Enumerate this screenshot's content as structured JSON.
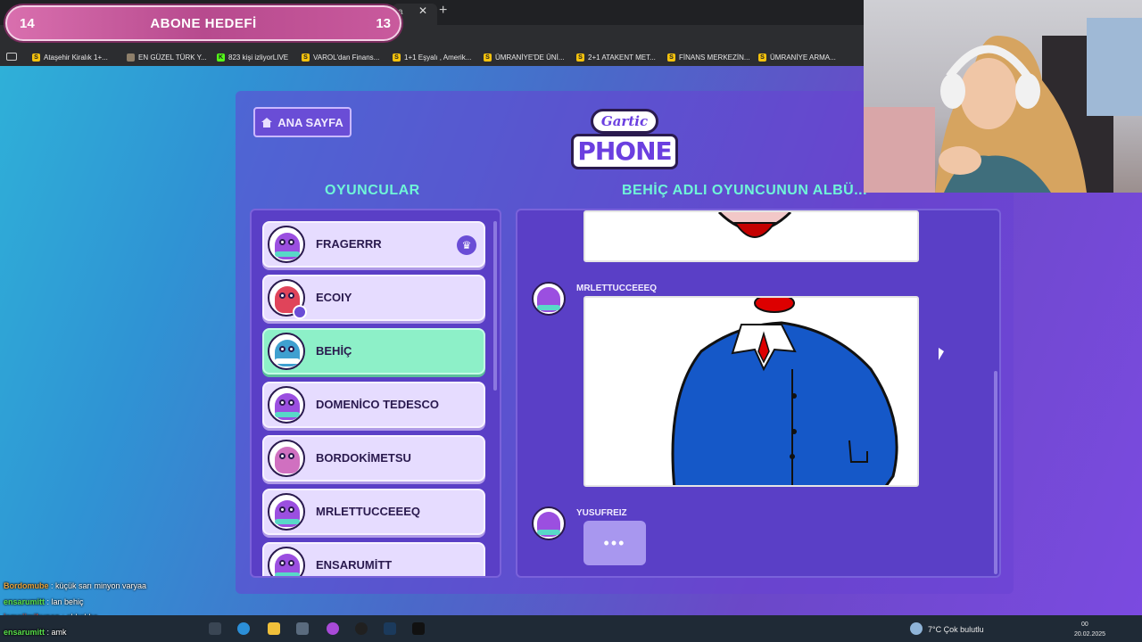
{
  "browser": {
    "tab_fragment": "a",
    "bookmarks": [
      {
        "icon": "S",
        "color": "#f4c20d",
        "label": "Ataşehir Kiralık 1+..."
      },
      {
        "icon": "",
        "color": "#8e7f6a",
        "label": "EN GÜZEL TÜRK Y..."
      },
      {
        "icon": "K",
        "color": "#53fc18",
        "label": "823 kişi izliyorLIVE"
      },
      {
        "icon": "S",
        "color": "#f4c20d",
        "label": "VAROL'dan Finans..."
      },
      {
        "icon": "S",
        "color": "#f4c20d",
        "label": "1+1 Eşyalı , Amerik..."
      },
      {
        "icon": "S",
        "color": "#f4c20d",
        "label": "ÜMRANİYE'DE ÜNİ..."
      },
      {
        "icon": "S",
        "color": "#f4c20d",
        "label": "2+1 ATAKENT MET..."
      },
      {
        "icon": "S",
        "color": "#f4c20d",
        "label": "FİNANS MERKEZİN..."
      },
      {
        "icon": "S",
        "color": "#f4c20d",
        "label": "ÜMRANİYE ARMA..."
      }
    ]
  },
  "goal": {
    "current": "14",
    "title": "ABONE HEDEFİ",
    "target": "13"
  },
  "game": {
    "home_label": "ANA SAYFA",
    "logo_top": "Gartic",
    "logo_bottom": "PHONE",
    "players_title": "OYUNCULAR",
    "album_title": "BEHİÇ ADLI OYUNCUNUN ALBÜ..."
  },
  "players": [
    {
      "name": "FRAGERRR",
      "color": "#9b4fe0",
      "crown": true,
      "active": false
    },
    {
      "name": "ECOIY",
      "color": "#e0445a",
      "badge": true,
      "active": false
    },
    {
      "name": "BEHİÇ",
      "color": "#3fa0d0",
      "active": true
    },
    {
      "name": "DOMENİCO TEDESCO",
      "color": "#9b4fe0",
      "active": false
    },
    {
      "name": "BORDOKİMETSU",
      "color": "#d070c0",
      "active": false
    },
    {
      "name": "MRLETTUCCEEEQ",
      "color": "#9b4fe0",
      "active": false
    },
    {
      "name": "ENSARUMİTT",
      "color": "#9b4fe0",
      "active": false
    }
  ],
  "album": {
    "entries": [
      {
        "author": "MRLETTUCCEEEQ"
      },
      {
        "author": "YUSUFREIZ",
        "typing": "•••"
      }
    ]
  },
  "chat": [
    {
      "user": "Bordomube",
      "color": "#e8a33d",
      "text": ": küçük sarı minyon varyaa"
    },
    {
      "user": "ensarumitt",
      "color": "#58e04a",
      "text": ": lan behiç"
    },
    {
      "user": "jempiimikunan",
      "color": "#d0443a",
      "text": ": ahhahha"
    },
    {
      "user": "ensarumitt",
      "color": "#58e04a",
      "text": ": amk"
    }
  ],
  "taskbar": {
    "weather": "7°C  Çok bulutlu",
    "time": "00",
    "date": "20.02.2025"
  },
  "colors": {
    "accent": "#6ff5d8",
    "panel": "#5a3fc6",
    "active_player": "#8df0c8"
  }
}
